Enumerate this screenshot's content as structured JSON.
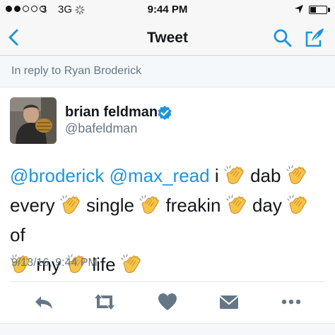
{
  "status_bar": {
    "carrier": "3",
    "network": "3G",
    "time": "9:44 PM"
  },
  "nav": {
    "title": "Tweet"
  },
  "reply_context": {
    "text": "In reply to Ryan Broderick"
  },
  "author": {
    "display_name": "brian feldman",
    "handle": "@bafeldman"
  },
  "tweet": {
    "mention_1": "@broderick",
    "mention_2": "@max_read",
    "word_i": "i",
    "word_dab": "dab",
    "word_every": "every",
    "word_single": "single",
    "word_freakin": "freakin",
    "word_day": "day",
    "word_of": "of",
    "word_my": "my",
    "word_life": "life",
    "emoji": "clapping-hands-emoji"
  },
  "timestamp": "9/13/16, 9:44 PM",
  "colors": {
    "accent": "#1b95e0",
    "secondary_text": "#657786",
    "action_icon": "#657786",
    "header_bg": "#f7f7f7"
  },
  "icons": [
    "back-chevron-icon",
    "search-icon",
    "compose-icon",
    "verified-icon",
    "reply-icon",
    "retweet-icon",
    "heart-icon",
    "direct-message-icon",
    "more-icon"
  ]
}
